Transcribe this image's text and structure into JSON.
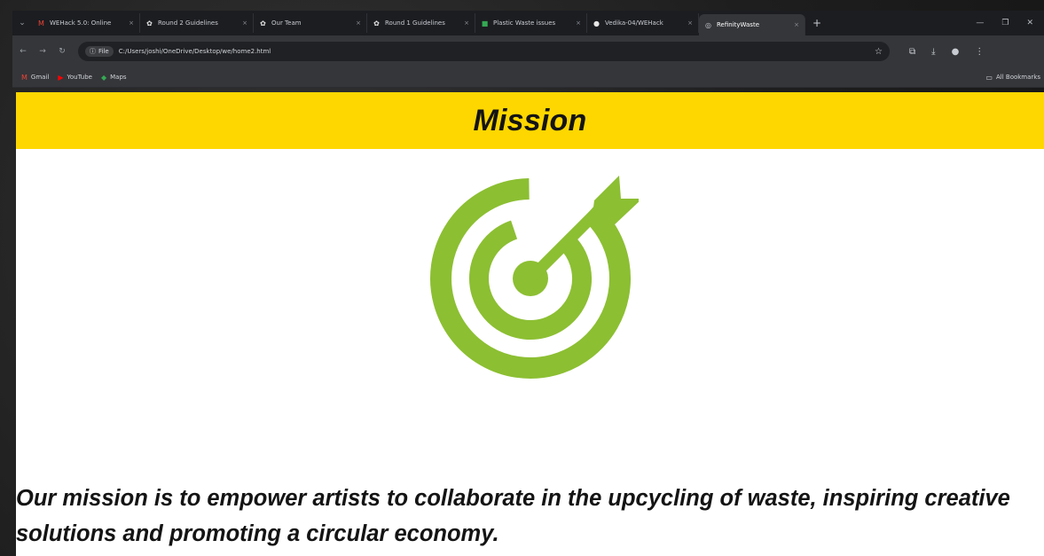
{
  "browser": {
    "tabs": [
      {
        "label": "WEHack 5.0: Online",
        "icon": "gmail-icon",
        "glyph": "M",
        "color": "#ea4335",
        "active": false
      },
      {
        "label": "Round 2 Guidelines",
        "icon": "hackathon-icon",
        "glyph": "✿",
        "color": "#e6e6e6",
        "active": false
      },
      {
        "label": "Our Team",
        "icon": "hackathon-icon",
        "glyph": "✿",
        "color": "#e6e6e6",
        "active": false
      },
      {
        "label": "Round 1 Guidelines",
        "icon": "hackathon-icon",
        "glyph": "✿",
        "color": "#e6e6e6",
        "active": false
      },
      {
        "label": "Plastic Waste issues",
        "icon": "sheets-icon",
        "glyph": "■",
        "color": "#34a853",
        "active": false
      },
      {
        "label": "Vedika-04/WEHack",
        "icon": "github-icon",
        "glyph": "●",
        "color": "#e6e6e6",
        "active": false
      },
      {
        "label": "RefinityWaste",
        "icon": "globe-icon",
        "glyph": "◎",
        "color": "#c8ccd2",
        "active": true
      }
    ],
    "tab_close": "×",
    "new_tab": "+",
    "window_controls": {
      "minimize": "—",
      "restore": "❐",
      "close": "✕"
    },
    "address_chip": "File",
    "address_chip_icon": "ⓘ",
    "url": "C:/Users/joshi/OneDrive/Desktop/we/home2.html",
    "bookmarks": [
      {
        "label": "Gmail",
        "glyph": "M",
        "color": "#ea4335"
      },
      {
        "label": "YouTube",
        "glyph": "▶",
        "color": "#ff0000"
      },
      {
        "label": "Maps",
        "glyph": "◆",
        "color": "#34a853"
      }
    ],
    "all_bookmarks": "All Bookmarks"
  },
  "page": {
    "title": "Mission",
    "header_color": "#fed700",
    "icon": "target-arrow-icon",
    "icon_color": "#8cbf32",
    "mission_text": "Our mission is to empower artists to collaborate in the upcycling of waste, inspiring creative solutions and promoting a circular economy."
  }
}
